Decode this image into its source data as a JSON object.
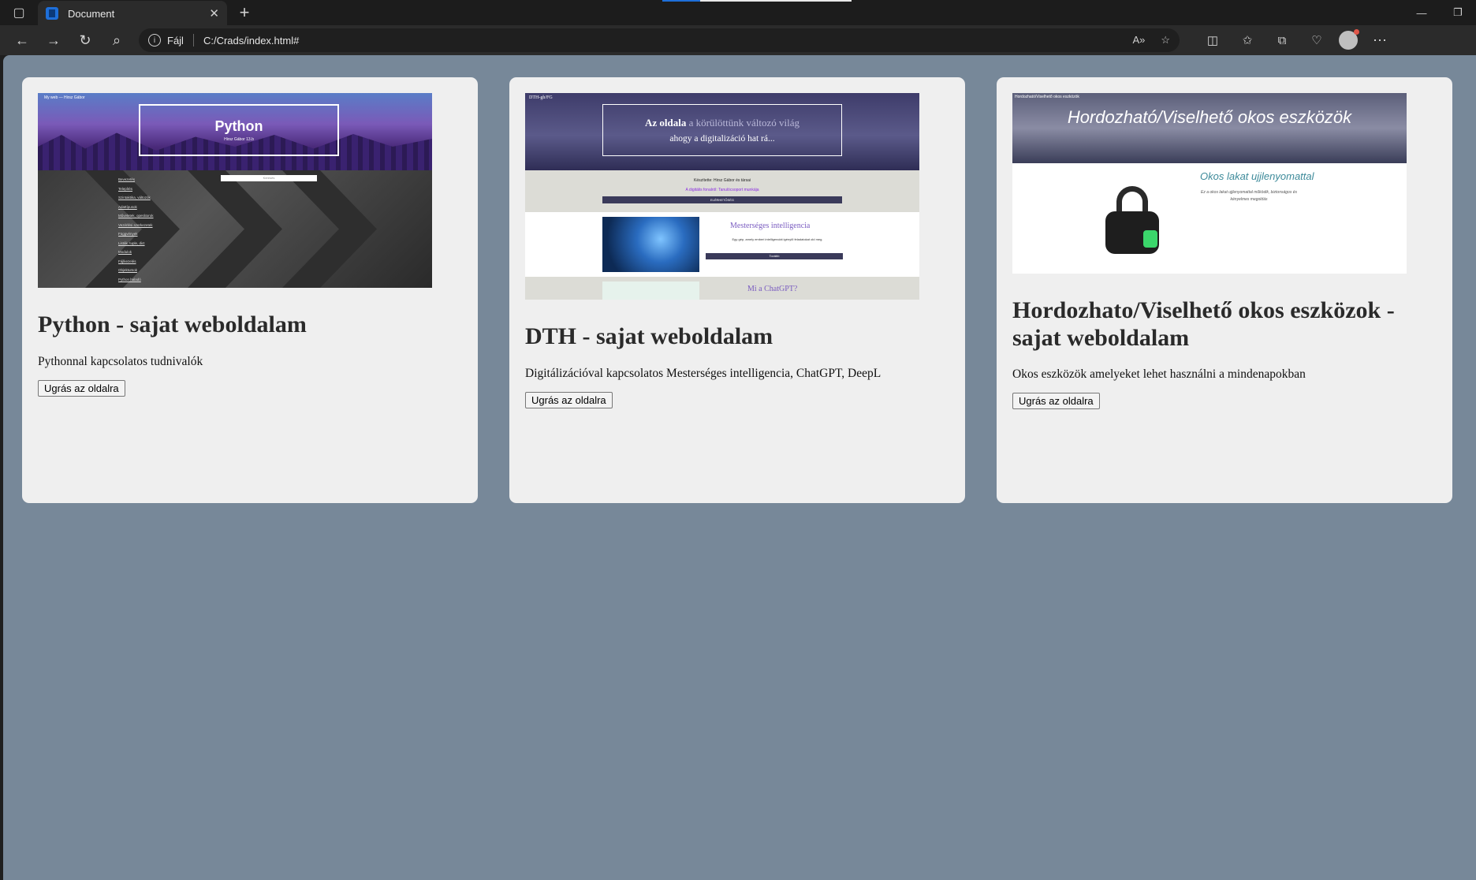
{
  "browser": {
    "tab_title": "Document",
    "address_label": "Fájl",
    "url": "C:/Crads/index.html#"
  },
  "cards": [
    {
      "title": "Python - sajat weboldalam",
      "description": "Pythonnal kapcsolatos tudnivalók",
      "button": "Ugrás az oldalra",
      "thumb": {
        "nav": "My web — Hirsz Gábor",
        "heading": "Python",
        "sub": "Hirsz Gábor 13.b",
        "search": "Keresés",
        "list": [
          "Bevezetés",
          "Telepítés",
          "Szintaktika, változók",
          "Adattípusok",
          "Műveletek, operátorok",
          "Vezérlési szerkezetek",
          "Függvények",
          "Listák, tuple, dict",
          "Modulok",
          "Fájlkezelés",
          "Objektumok",
          "Python haladó"
        ]
      }
    },
    {
      "title": "DTH - sajat weboldalam",
      "description": "Digitálizációval kapcsolatos Mesterséges intelligencia, ChatGPT, DeepL",
      "button": "Ugrás az oldalra",
      "thumb": {
        "tag": "DTH-gh/FG",
        "hero_bold": "Az oldala",
        "hero_rest": " a körülöttünk változó világ",
        "hero_line2": "ahogy a digitalizáció hat rá...",
        "sec1_line1": "Készítette: Hirsz Gábor és társai",
        "sec1_line2": "A digitális fonalról: Tanulócsoport munkája",
        "sec1_bar": "ELÉRHETŐSÉG",
        "sec2_title": "Mesterséges intelligencia",
        "sec2_text": "Egy gép, amely emberi intelligenciát igénylő feladatokat old meg.",
        "sec2_btn": "Tovább",
        "sec3_title": "Mi a ChatGPT?"
      }
    },
    {
      "title": "Hordozhato/Viselhető okos eszközok - sajat weboldalam",
      "description": "Okos eszközök amelyeket lehet használni a mindenapokban",
      "button": "Ugrás az oldalra",
      "thumb": {
        "tag": "Hordozható/Viselhető okos eszközök",
        "heading": "Hordozható/Viselhető okos eszközök",
        "sub_title": "Okos lakat ujjlenyomattal",
        "sub_text": "Ez a okos lakat ujjlenyomattal működik, biztonságos és kényelmes megoldás"
      }
    }
  ]
}
